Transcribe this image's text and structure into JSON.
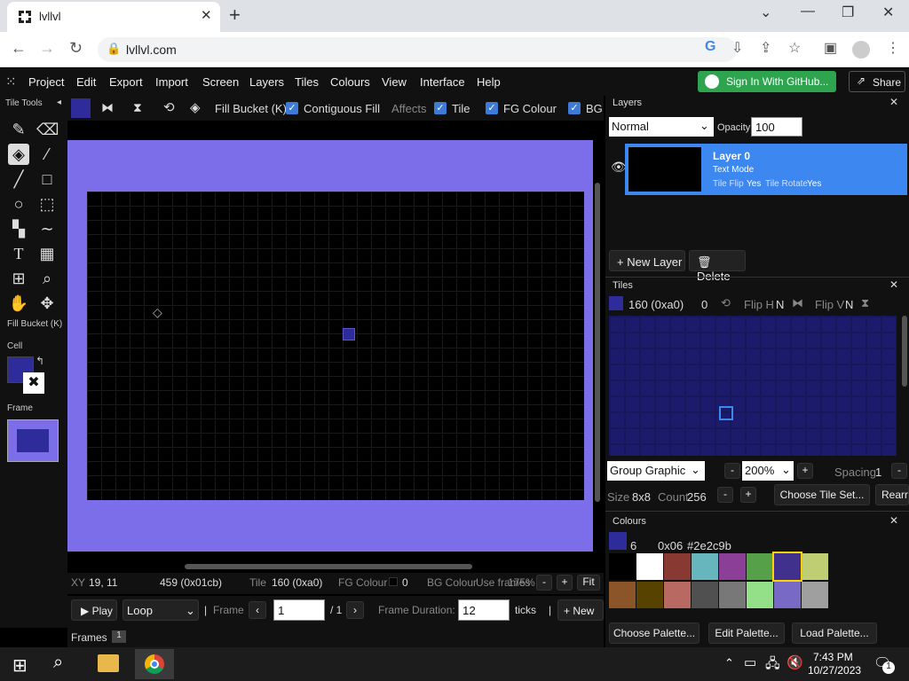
{
  "browser": {
    "tab_title": "lvllvl",
    "url": "lvllvl.com"
  },
  "menu": [
    "Project",
    "Edit",
    "Export",
    "Import",
    "Screen",
    "Layers",
    "Tiles",
    "Colours",
    "View",
    "Interface",
    "Help"
  ],
  "github_label": "Sign In With GitHub...",
  "share_label": "Share",
  "tool_panel": {
    "title": "Tile Tools",
    "current_tool": "Fill Bucket (K)",
    "cell_label": "Cell",
    "frame_label": "Frame"
  },
  "toolbar": {
    "tool_name": "Fill Bucket (K)",
    "contiguous_label": "Contiguous Fill",
    "affects_label": "Affects",
    "tile_label": "Tile",
    "fg_label": "FG Colour",
    "bg_label": "BG"
  },
  "status": {
    "xy_label": "XY",
    "xy_value": "19, 11",
    "index": "459 (0x01cb)",
    "tile_label": "Tile",
    "tile_value": "160 (0xa0)",
    "fg_label": "FG Colour",
    "fg_value": "0",
    "bg_label": "BG Colour",
    "overlap": "Use frames",
    "zoom": "175%",
    "fit_label": "Fit"
  },
  "playbar": {
    "play_label": "Play",
    "loop_value": "Loop",
    "frame_label": "Frame",
    "frame_value": "1",
    "frame_total": "/ 1",
    "duration_label": "Frame Duration:",
    "duration_value": "12",
    "ticks_label": "ticks",
    "new_label": "New"
  },
  "frames_label": "Frames",
  "frames_count": "1",
  "layers_panel": {
    "title": "Layers",
    "blend_mode": "Normal",
    "opacity_label": "Opacity:",
    "opacity_value": "100",
    "layer_name": "Layer 0",
    "layer_mode": "Text Mode",
    "flip_label": "Tile Flip",
    "flip_value": "Yes",
    "rotate_label": "Tile Rotate",
    "rotate_value": "Yes",
    "new_layer_label": "New Layer",
    "delete_label": "Delete"
  },
  "tiles_panel": {
    "title": "Tiles",
    "tile_id": "160 (0xa0)",
    "rotation": "0",
    "flip_h_label": "Flip H",
    "flip_h_value": "N",
    "flip_v_label": "Flip V",
    "flip_v_value": "N",
    "group_value": "Group Graphic",
    "zoom_value": "200%",
    "spacing_label": "Spacing",
    "spacing_value": "1",
    "size_label": "Size",
    "size_value": "8x8",
    "count_label": "Count",
    "count_value": "256",
    "choose_tileset_label": "Choose Tile Set...",
    "rearrange_label": "Rearra"
  },
  "colours_panel": {
    "title": "Colours",
    "index": "6",
    "hex": "0x06",
    "color_hex": "#2e2c9b",
    "choose_palette_label": "Choose Palette...",
    "edit_palette_label": "Edit Palette...",
    "load_palette_label": "Load Palette...",
    "palette": [
      "#000000",
      "#ffffff",
      "#883932",
      "#67b6bd",
      "#8b3f96",
      "#55a049",
      "#40318d",
      "#bfce72",
      "#8b5429",
      "#574200",
      "#b86962",
      "#505050",
      "#787878",
      "#94e089",
      "#7869c4",
      "#9f9f9f"
    ]
  },
  "taskbar": {
    "time": "7:43 PM",
    "date": "10/27/2023",
    "notif_count": "1"
  }
}
